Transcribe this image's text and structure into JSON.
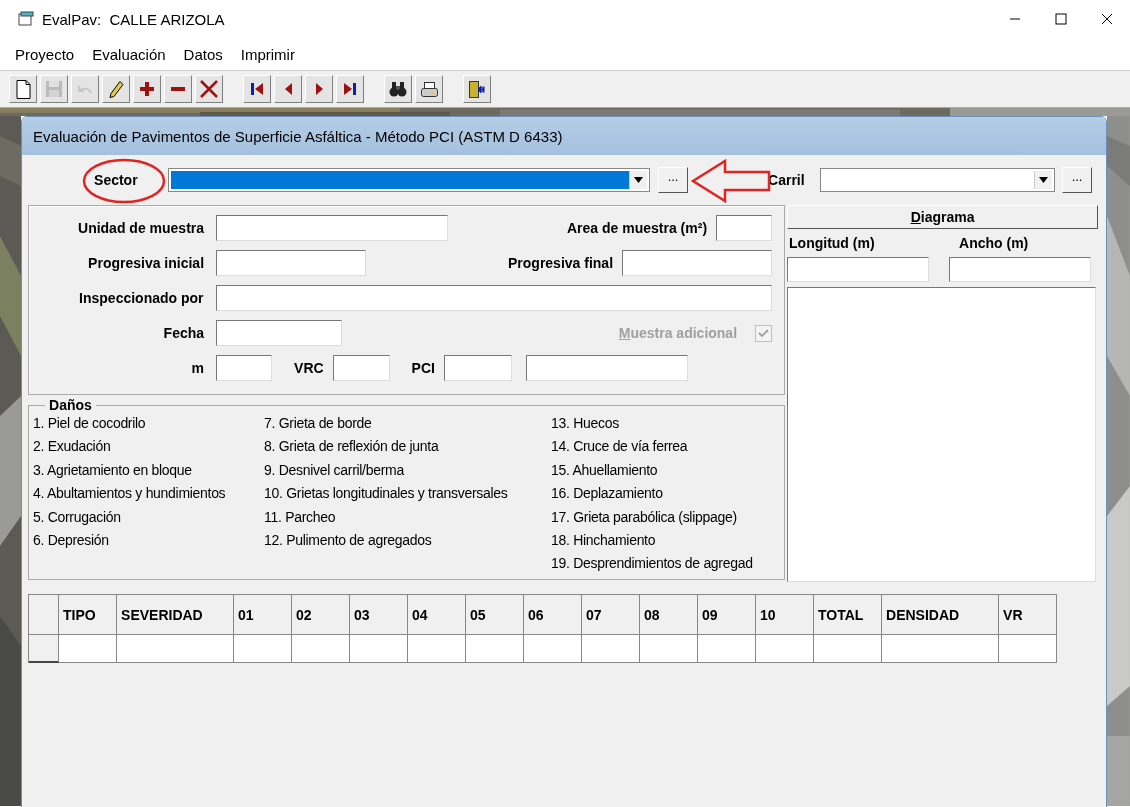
{
  "window": {
    "title": "EvalPav:  CALLE ARIZOLA"
  },
  "menu": [
    {
      "label": "Proyecto"
    },
    {
      "label": "Evaluación"
    },
    {
      "label": "Datos"
    },
    {
      "label": "Imprimir"
    }
  ],
  "toolbar": [
    [
      {
        "kind": "new",
        "disabled": false
      },
      {
        "kind": "save",
        "disabled": true
      },
      {
        "kind": "undo",
        "disabled": true
      },
      {
        "kind": "edit",
        "disabled": false
      },
      {
        "kind": "add",
        "disabled": false
      },
      {
        "kind": "remove",
        "disabled": false
      },
      {
        "kind": "delete",
        "disabled": false
      }
    ],
    [
      {
        "kind": "first",
        "disabled": false
      },
      {
        "kind": "prev",
        "disabled": false
      },
      {
        "kind": "next",
        "disabled": false
      },
      {
        "kind": "last",
        "disabled": false
      }
    ],
    [
      {
        "kind": "find",
        "disabled": false
      },
      {
        "kind": "print",
        "disabled": false
      }
    ],
    [
      {
        "kind": "exit",
        "disabled": false
      }
    ]
  ],
  "form": {
    "title": "Evaluación de Pavimentos de Superficie Asfáltica - Método PCI (ASTM D 6433)",
    "sector": {
      "label": "Sector",
      "highlighted": true,
      "button": "..."
    },
    "carril": {
      "label": "Carril",
      "highlighted": false,
      "button": "..."
    },
    "annotations": [
      {
        "kind": "ellipse"
      },
      {
        "kind": "arrow"
      }
    ],
    "rows": [
      [
        {
          "kind": "field",
          "label": "Unidad de muestra"
        },
        {
          "kind": "field",
          "label": "Area de muestra (m²)"
        }
      ],
      [
        {
          "kind": "field",
          "label": "Progresiva inicial"
        },
        {
          "kind": "field",
          "label": "Progresiva final"
        }
      ],
      [
        {
          "kind": "field",
          "label": "Inspeccionado por"
        }
      ],
      [
        {
          "kind": "field",
          "label": "Fecha"
        },
        {
          "kind": "checkbox",
          "label": "Muestra adicional",
          "mnemonic": true,
          "checked": true,
          "disabled": true
        }
      ],
      [
        {
          "kind": "field",
          "label": "m"
        },
        {
          "kind": "field",
          "label": "VRC"
        },
        {
          "kind": "field",
          "label": "PCI"
        },
        {
          "kind": "field"
        }
      ]
    ],
    "diagram": {
      "button": {
        "label": "Diagrama",
        "mnemonic": true
      },
      "length_label": "Longitud (m)",
      "width_label": "Ancho (m)"
    },
    "damages": {
      "title": "Daños",
      "columns": [
        [
          "1. Piel de cocodrilo",
          "2. Exudación",
          "3. Agrietamiento en bloque",
          "4. Abultamientos y hundimientos",
          "5. Corrugación",
          "6. Depresión"
        ],
        [
          "7. Grieta de borde",
          "8. Grieta de reflexión de junta",
          "9. Desnivel carril/berma",
          "10. Grietas longitudinales y transversales",
          "11. Parcheo",
          "12. Pulimento de agregados"
        ],
        [
          "13. Huecos",
          "14. Cruce de vía ferrea",
          "15. Ahuellamiento",
          "16. Deplazamiento",
          "17. Grieta parabólica (slippage)",
          "18. Hinchamiento",
          "19. Desprendimientos de agregad"
        ]
      ]
    },
    "table": {
      "columns": [
        "TIPO",
        "SEVERIDAD",
        "01",
        "02",
        "03",
        "04",
        "05",
        "06",
        "07",
        "08",
        "09",
        "10",
        "TOTAL",
        "DENSIDAD",
        "VR"
      ]
    }
  }
}
